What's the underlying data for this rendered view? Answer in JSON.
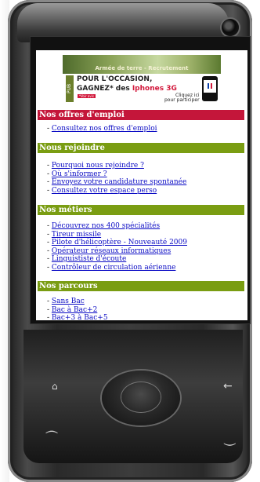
{
  "ad": {
    "photo_caption": "Armée de terre - Recrutement",
    "pub_label": "PUB",
    "line1": "POUR L'OCCASION,",
    "line2_prefix": "GAGNEZ* des ",
    "line2_highlight": "Iphones 3G",
    "small_tag": "*Voir avis",
    "cta_line1": "Cliquez ici",
    "cta_line2": "pour participer"
  },
  "sections": {
    "offres": {
      "title": "Nos offres d'emploi",
      "items": [
        "Consultez nos offres d'emploi"
      ]
    },
    "rejoindre": {
      "title": "Nous rejoindre",
      "items": [
        "Pourquoi nous rejoindre ?",
        "Où s'informer ?",
        "Envoyez votre candidature spontanée",
        "Consultez votre espace perso"
      ]
    },
    "metiers": {
      "title": "Nos métiers",
      "items": [
        "Découvrez nos 400 spécialités",
        "Tireur missile",
        "Pilote d'hélicoptère - Nouveauté 2009",
        "Opérateur réseaux informatiques",
        "Linguististe d'écoute",
        "Contrôleur de circulation aérienne"
      ]
    },
    "parcours": {
      "title": "Nos parcours",
      "items": [
        "Sans Bac",
        "Bac à Bac+2",
        "Bac+3 à Bac+5"
      ]
    }
  },
  "bullet": "- ",
  "hardware": {
    "home_glyph": "⌂",
    "back_glyph": "←",
    "call_glyph": "⏜",
    "end_glyph": "⏝"
  },
  "colors": {
    "red_section": "#c4163a",
    "green_section": "#7a9d12",
    "link": "#0a0ac4"
  }
}
